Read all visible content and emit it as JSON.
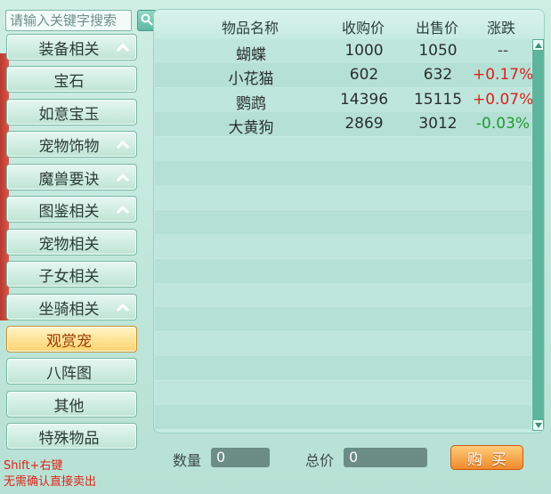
{
  "search": {
    "placeholder": "请输入关键字搜索"
  },
  "sidebar": {
    "items": [
      {
        "label": "装备相关",
        "expandable": true
      },
      {
        "label": "宝石",
        "expandable": false
      },
      {
        "label": "如意宝玉",
        "expandable": false
      },
      {
        "label": "宠物饰物",
        "expandable": true
      },
      {
        "label": "魔兽要诀",
        "expandable": true
      },
      {
        "label": "图鉴相关",
        "expandable": true
      },
      {
        "label": "宠物相关",
        "expandable": false
      },
      {
        "label": "子女相关",
        "expandable": false
      },
      {
        "label": "坐骑相关",
        "expandable": true
      },
      {
        "label": "观赏宠",
        "expandable": false,
        "selected": true
      },
      {
        "label": "八阵图",
        "expandable": false
      },
      {
        "label": "其他",
        "expandable": false
      },
      {
        "label": "特殊物品",
        "expandable": false
      }
    ]
  },
  "table": {
    "headers": {
      "name": "物品名称",
      "buy": "收购价",
      "sell": "出售价",
      "change": "涨跌"
    },
    "rows": [
      {
        "name": "蝴蝶",
        "buy": "1000",
        "sell": "1050",
        "change": "--",
        "trend": "flat"
      },
      {
        "name": "小花猫",
        "buy": "602",
        "sell": "632",
        "change": "+0.17%",
        "trend": "up"
      },
      {
        "name": "鹦鹉",
        "buy": "14396",
        "sell": "15115",
        "change": "+0.07%",
        "trend": "up"
      },
      {
        "name": "大黄狗",
        "buy": "2869",
        "sell": "3012",
        "change": "-0.03%",
        "trend": "down"
      }
    ]
  },
  "footer": {
    "quantity_label": "数量",
    "quantity_value": "0",
    "total_label": "总价",
    "total_value": "0",
    "buy_label": "购买",
    "hint_line1": "Shift+右键",
    "hint_line2": "无需确认直接卖出"
  },
  "colors": {
    "up": "#d8231b",
    "down": "#1f9a2f",
    "accent": "#f08a2c"
  }
}
